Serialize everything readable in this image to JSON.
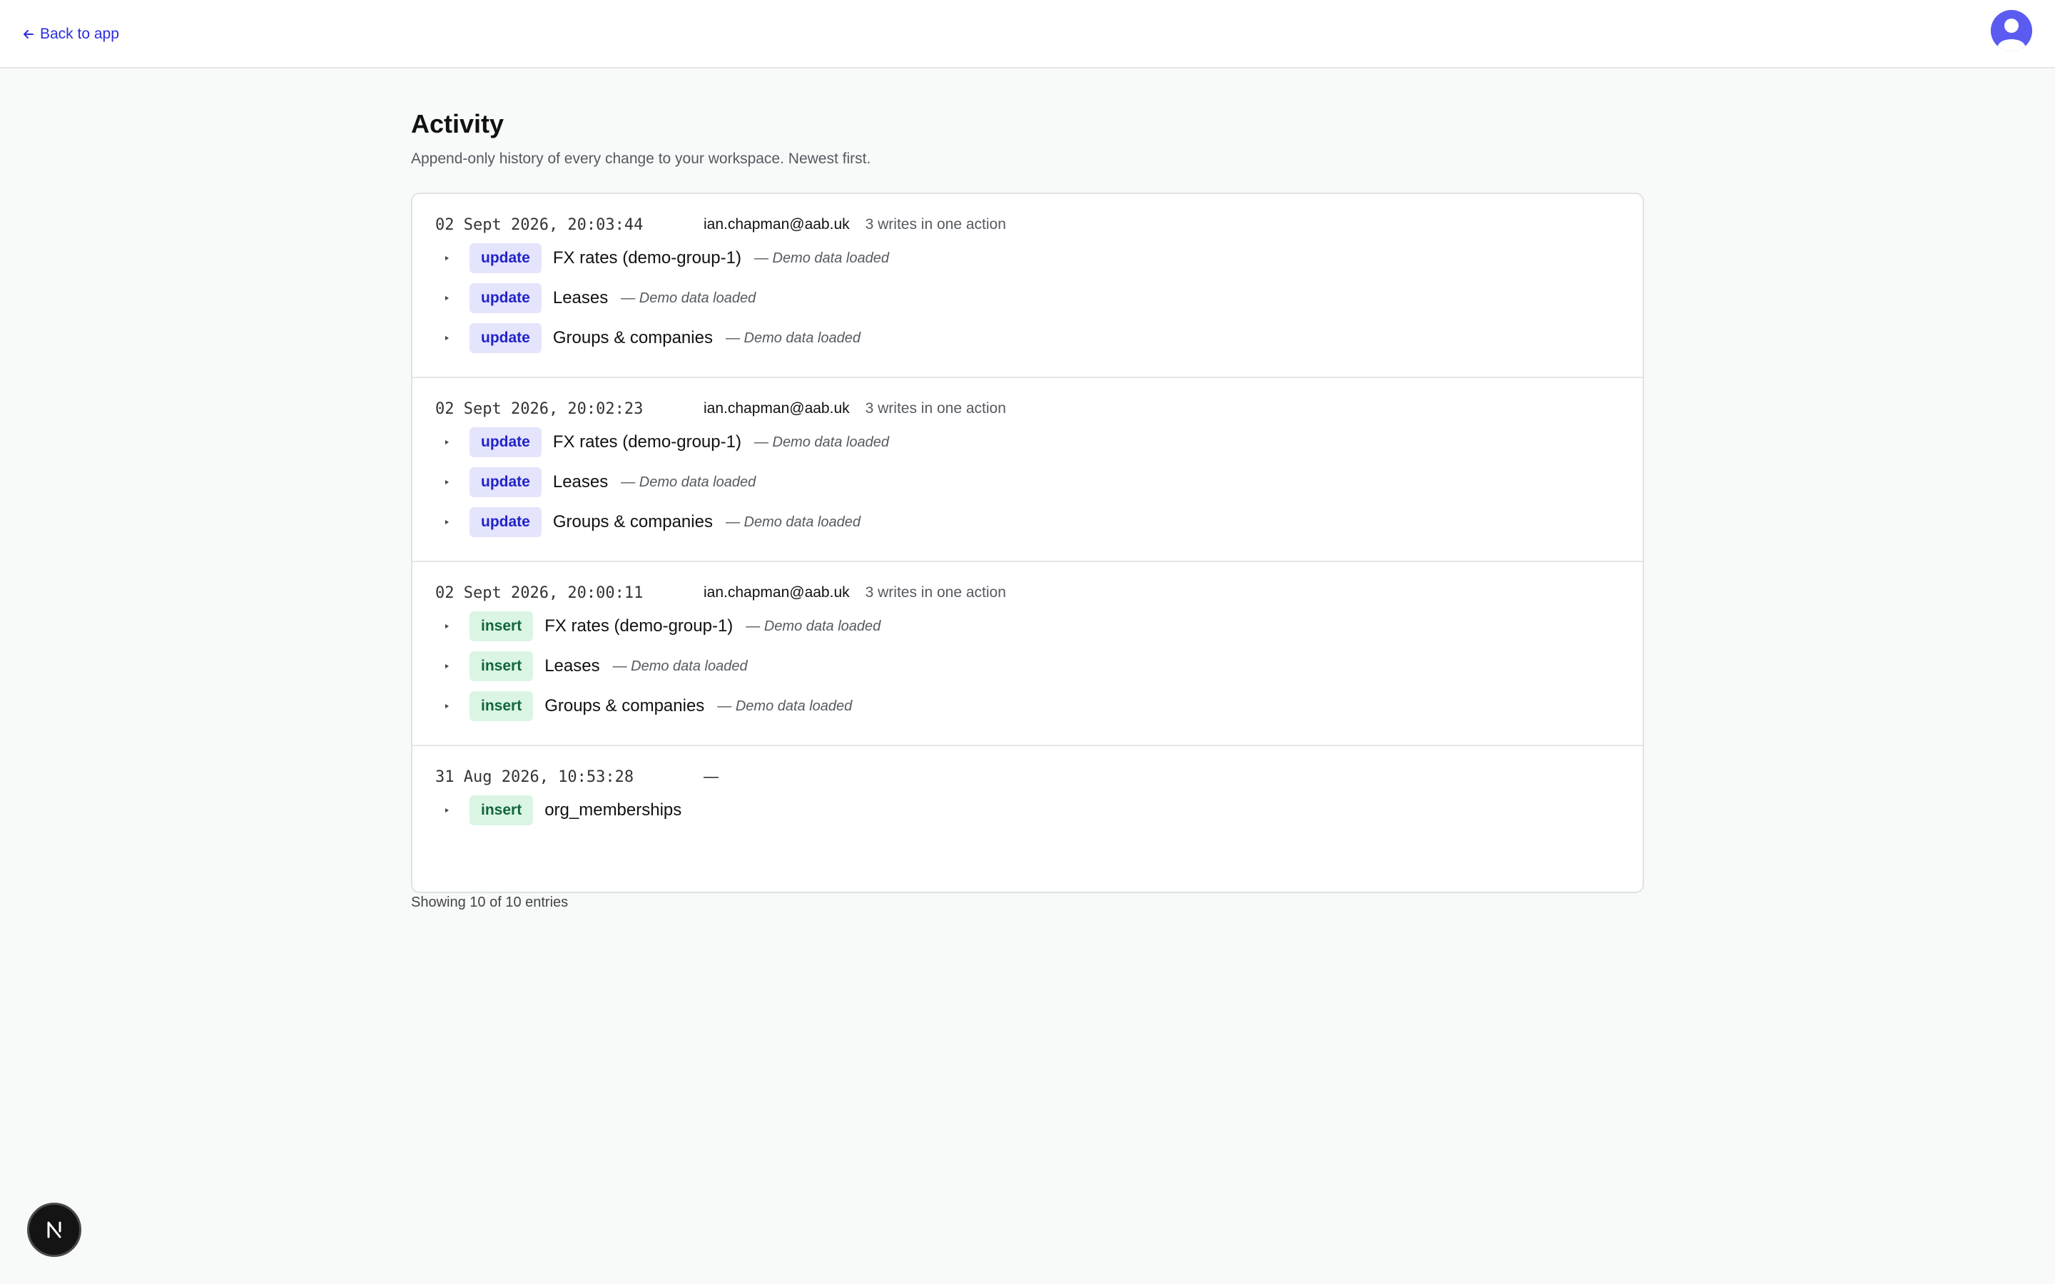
{
  "header": {
    "back_label": "Back to app",
    "avatar_icon": "user-avatar-icon"
  },
  "page": {
    "title": "Activity",
    "subtitle": "Append-only history of every change to your workspace. Newest first."
  },
  "groups": [
    {
      "timestamp": "02 Sept 2026, 20:03:44",
      "user": "ian.chapman@aab.uk",
      "summary": "3 writes in one action",
      "entries": [
        {
          "action": "update",
          "entity": "FX rates (demo-group-1)",
          "note": "— Demo data loaded"
        },
        {
          "action": "update",
          "entity": "Leases",
          "note": "— Demo data loaded"
        },
        {
          "action": "update",
          "entity": "Groups & companies",
          "note": "— Demo data loaded"
        }
      ]
    },
    {
      "timestamp": "02 Sept 2026, 20:02:23",
      "user": "ian.chapman@aab.uk",
      "summary": "3 writes in one action",
      "entries": [
        {
          "action": "update",
          "entity": "FX rates (demo-group-1)",
          "note": "— Demo data loaded"
        },
        {
          "action": "update",
          "entity": "Leases",
          "note": "— Demo data loaded"
        },
        {
          "action": "update",
          "entity": "Groups & companies",
          "note": "— Demo data loaded"
        }
      ]
    },
    {
      "timestamp": "02 Sept 2026, 20:00:11",
      "user": "ian.chapman@aab.uk",
      "summary": "3 writes in one action",
      "entries": [
        {
          "action": "insert",
          "entity": "FX rates (demo-group-1)",
          "note": "— Demo data loaded"
        },
        {
          "action": "insert",
          "entity": "Leases",
          "note": "— Demo data loaded"
        },
        {
          "action": "insert",
          "entity": "Groups & companies",
          "note": "— Demo data loaded"
        }
      ]
    },
    {
      "timestamp": "31 Aug 2026, 10:53:28",
      "user": "—",
      "summary": "",
      "entries": [
        {
          "action": "insert",
          "entity": "org_memberships",
          "note": ""
        }
      ]
    }
  ],
  "footer": {
    "count_text": "Showing 10 of 10 entries"
  },
  "dev_badge": {
    "icon": "nextjs-logo-icon",
    "letter": "N"
  }
}
